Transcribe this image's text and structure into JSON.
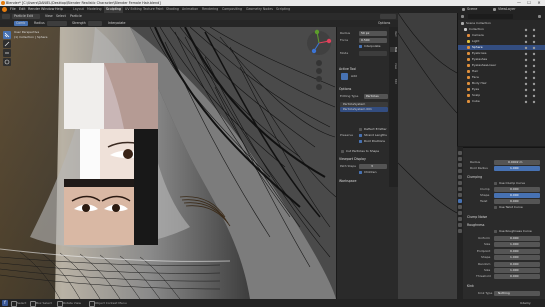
{
  "window": {
    "title": "Blender* [C:\\Users\\DANIEL\\Desktop\\Blender Realistic Character\\Blender Female Hair.blend]",
    "minimize": "—",
    "maximize": "☐",
    "close": "✕"
  },
  "menubar": {
    "items": [
      "File",
      "Edit",
      "Render",
      "Window",
      "Help"
    ],
    "workspaces": [
      "Layout",
      "Modeling",
      "Sculpting",
      "UV Editing",
      "Texture Paint",
      "Shading",
      "Animation",
      "Rendering",
      "Compositing",
      "Geometry Nodes",
      "Scripting"
    ],
    "active_workspace": "Sculpting",
    "scene": "Scene",
    "view_layer": "ViewLayer"
  },
  "viewport_header": {
    "mode": "Particle Edit",
    "view": "View",
    "select": "Select",
    "particle": "Particle",
    "comb_label": "Comb",
    "radius_label": "Radius",
    "strength_label": "Strength",
    "interpolate": "Interpolate",
    "options": "Options"
  },
  "viewport": {
    "view_info_1": "User Perspective",
    "view_info_2": "(1) Collection | Sphere"
  },
  "npanel": {
    "tabs": [
      "Item",
      "Tool",
      "View",
      "Edit"
    ],
    "radius_label": "Radius",
    "radius_value": "50 px",
    "strength_label": "Force",
    "strength_value": "0.500",
    "interpolate_label": "Interpolate",
    "mode_label": "Mode",
    "active_tool_section": "Active Tool",
    "tool_name": "Add",
    "options_section": "Options",
    "editing_type_label": "Editing Type",
    "editing_type_value": "Particles",
    "ps_name_1": "ParticleSystem",
    "ps_name_2": "ParticleSystem.001",
    "deflect_emitter": "Deflect Emitter",
    "preserve": "Preserve",
    "preserve_lengths": "Strand Lengths",
    "preserve_root": "Root Positions",
    "cut_particles": "Cut Particles to Shape",
    "viewport_display_section": "Viewport Display",
    "path_steps_label": "Path Steps",
    "path_steps_value": "3",
    "children_label": "Children",
    "workspace_section": "Workspace"
  },
  "outliner": {
    "header": "Scene Collection",
    "rows": [
      "Scene Collection",
      "Collection",
      "Camera",
      "Light",
      "Sphere",
      "Eyebrows",
      "Eyelashes",
      "EyelashesLower",
      "Hair",
      "Face",
      "Body Hair",
      "Eyes",
      "Scalp",
      "Cube"
    ]
  },
  "properties": {
    "radius_label": "Radius",
    "radius_value": "0.0002 m",
    "rootradius_label": "Root Radius",
    "rootradius_value": "1.000",
    "clumping_section": "Clumping",
    "use_clump_curve": "Use Clump Curve",
    "clump_label": "Clump",
    "clump_value": "0.000",
    "shape_label": "Shape",
    "shape_value": "0.000",
    "twist_label": "Twist",
    "twist_value": "0.000",
    "use_twist_curve": "Use Twist Curve",
    "clump_noise_section": "Clump Noise",
    "roughness_section": "Roughness",
    "use_rough_curve": "Use Roughness Curve",
    "uniform_label": "Uniform",
    "uniform_value": "0.000",
    "size_label": "Size",
    "size_value": "1.000",
    "endpoint_label": "Endpoint",
    "endpoint_value": "0.000",
    "shape2_label": "Shape",
    "shape2_value": "1.000",
    "random_label": "Random",
    "random_value": "0.000",
    "size2_label": "Size",
    "size2_value": "1.000",
    "threshold_label": "Threshold",
    "threshold_value": "0.000",
    "kink_section": "Kink",
    "kink_type_label": "Kink Type",
    "kink_type_value": "Nothing"
  },
  "statusbar": {
    "select": "Select",
    "box_select": "Box Select",
    "rotate": "Rotate View",
    "context": "Object Context Menu",
    "version": "Udemy"
  },
  "colors": {
    "accent": "#4772b3",
    "bg": "#1d1d1d",
    "panel": "#2b2b2b"
  }
}
